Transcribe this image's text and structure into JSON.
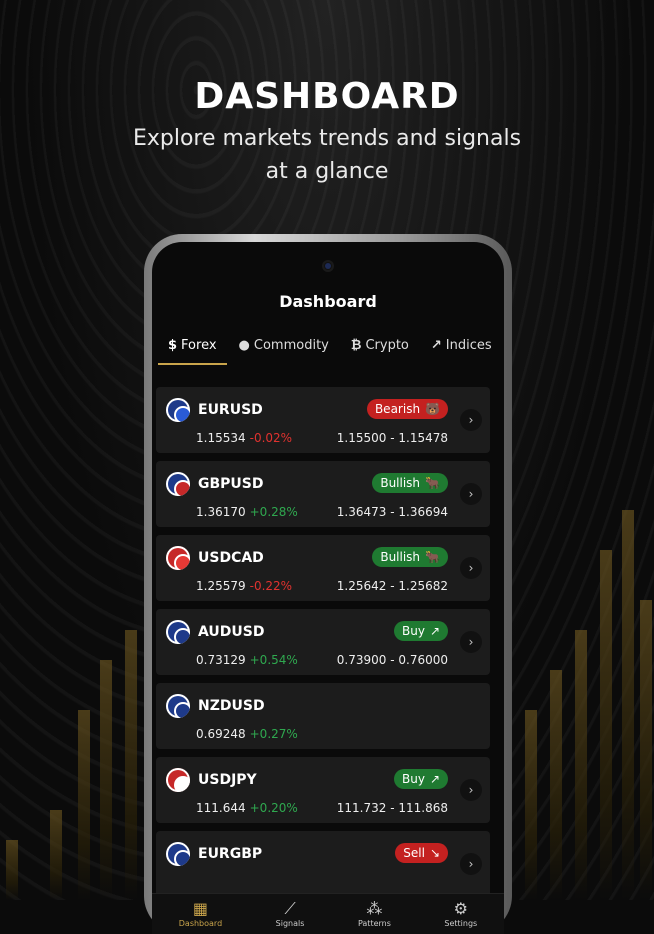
{
  "promo": {
    "title": "DASHBOARD",
    "subtitle_line1": "Explore markets trends and signals",
    "subtitle_line2": "at a glance"
  },
  "app": {
    "title": "Dashboard"
  },
  "tabs": [
    {
      "icon": "$",
      "label": "Forex",
      "active": true
    },
    {
      "icon": "💧",
      "label": "Commodity"
    },
    {
      "icon": "₿",
      "label": "Crypto"
    },
    {
      "icon": "↗",
      "label": "Indices"
    }
  ],
  "rows": [
    {
      "pair": "EURUSD",
      "price": "1.15534",
      "change": "-0.02%",
      "range": "1.15500 - 1.15478",
      "badge": "Bearish",
      "badge_color": "red",
      "flag_bg": "#1e3a8a",
      "flag_badge": "#2a5bd7"
    },
    {
      "pair": "GBPUSD",
      "price": "1.36170",
      "change": "+0.28%",
      "range": "1.36473 - 1.36694",
      "badge": "Bullish",
      "badge_color": "green",
      "flag_bg": "#1e3a8a",
      "flag_badge": "#c62828"
    },
    {
      "pair": "USDCAD",
      "price": "1.25579",
      "change": "-0.22%",
      "range": "1.25642 - 1.25682",
      "badge": "Bullish",
      "badge_color": "green",
      "flag_bg": "#c62828",
      "flag_badge": "#e53935"
    },
    {
      "pair": "AUDUSD",
      "price": "0.73129",
      "change": "+0.54%",
      "range": "0.73900 - 0.76000",
      "badge": "Buy",
      "badge_color": "green",
      "flag_bg": "#1e3a8a",
      "flag_badge": "#1e3a8a"
    },
    {
      "pair": "NZDUSD",
      "price": "0.69248",
      "change": "+0.27%",
      "range": "",
      "badge": "",
      "badge_color": "",
      "flag_bg": "#1e3a8a",
      "flag_badge": "#1e3a8a"
    },
    {
      "pair": "USDJPY",
      "price": "111.644",
      "change": "+0.20%",
      "range": "111.732 - 111.868",
      "badge": "Buy",
      "badge_color": "green",
      "flag_bg": "#c62828",
      "flag_badge": "#ffffff"
    },
    {
      "pair": "EURGBP",
      "price": "",
      "change": "",
      "range": "",
      "badge": "Sell",
      "badge_color": "red",
      "flag_bg": "#1e3a8a",
      "flag_badge": "#1e3a8a"
    }
  ],
  "nav": [
    {
      "label": "Dashboard",
      "icon": "dashboard-icon",
      "active": true
    },
    {
      "label": "Signals",
      "icon": "signals-icon"
    },
    {
      "label": "Patterns",
      "icon": "patterns-icon"
    },
    {
      "label": "Settings",
      "icon": "settings-icon"
    }
  ]
}
